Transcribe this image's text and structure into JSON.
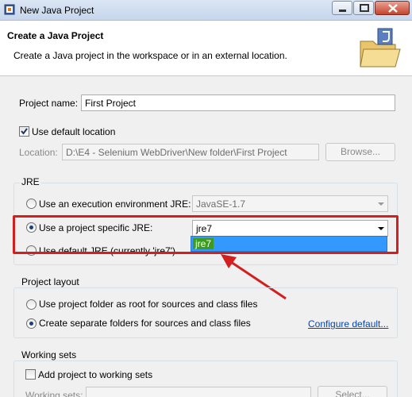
{
  "window": {
    "title": "New Java Project",
    "icons": [
      "java-app-icon",
      "minimize-icon",
      "maximize-icon",
      "close-icon"
    ]
  },
  "header": {
    "title": "Create a Java Project",
    "description": "Create a Java project in the workspace or in an external location.",
    "icon": "folder-java-icon"
  },
  "project": {
    "name_label": "Project name:",
    "name_value": "First Project",
    "default_location_label": "Use default location",
    "default_location_checked": true,
    "location_label": "Location:",
    "location_value": "D:\\E4 - Selenium WebDriver\\New folder\\First Project",
    "browse_label": "Browse..."
  },
  "jre": {
    "group_title": "JRE",
    "exec_env_label": "Use an execution environment JRE:",
    "exec_env_value": "JavaSE-1.7",
    "specific_label": "Use a project specific JRE:",
    "specific_value": "jre7",
    "specific_selected": true,
    "default_label": "Use default JRE (currently 'jre7')",
    "dropdown_option": "jre7"
  },
  "layout": {
    "group_title": "Project layout",
    "option_root_label": "Use project folder as root for sources and class files",
    "option_separate_label": "Create separate folders for sources and class files",
    "configure_link": "Configure default..."
  },
  "working_sets": {
    "group_title": "Working sets",
    "add_label": "Add project to working sets",
    "sets_label": "Working sets:",
    "select_label": "Select..."
  },
  "colors": {
    "highlight": "#d21f1f",
    "selection": "#3399ff",
    "dropdown_item": "#3b9c1f",
    "link": "#0645ad"
  }
}
